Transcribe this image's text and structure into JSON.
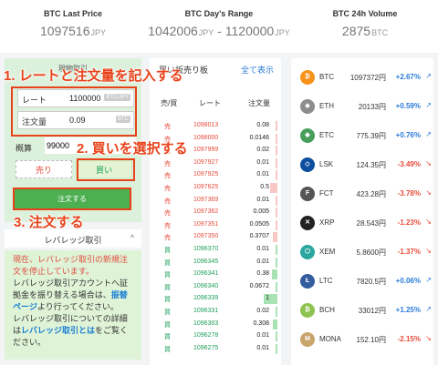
{
  "stats": [
    {
      "label": "BTC Last Price",
      "value": "1097516",
      "unit": "JPY"
    },
    {
      "label": "BTC Day's Range",
      "value": "1042006",
      "unit": "JPY",
      "sep": " - ",
      "value2": "1120000",
      "unit2": "JPY"
    },
    {
      "label": "BTC 24h Volume",
      "value": "2875",
      "unit": "BTC"
    }
  ],
  "order": {
    "title": "現物取引",
    "rate_label": "レート",
    "rate_value": "1100000",
    "rate_tag": "BTC/JPY",
    "amount_label": "注文量",
    "amount_value": "0.09",
    "amount_tag": "BTC",
    "estimate_label": "概算",
    "estimate_value": "99000",
    "sell_label": "売り",
    "buy_label": "買い",
    "submit_label": "注文する"
  },
  "leverage": {
    "header": "レバレッジ取引",
    "chevron": "^",
    "line1": "現在、レバレッジ取引の新規注文を停止しています。",
    "line2": "レバレッジ取引アカウントへ証拠金を振り替える場合は、",
    "link1": "振替ページ",
    "line3": "より行ってください。",
    "line4": "レバレッジ取引についての詳細は",
    "link2": "レバレッジ取引とは",
    "line5": "をご覧ください。"
  },
  "book": {
    "tab": "買い板売り板",
    "show_all": "全て表示",
    "headers": {
      "side": "売/買",
      "rate": "レート",
      "amount": "注文量"
    },
    "rows": [
      {
        "side": "売",
        "rate": "1098013",
        "amount": "0.08",
        "bar": 0.04,
        "type": "sell"
      },
      {
        "side": "売",
        "rate": "1098000",
        "amount": "0.0146",
        "bar": 0.01,
        "type": "sell"
      },
      {
        "side": "売",
        "rate": "1097999",
        "amount": "0.02",
        "bar": 0.01,
        "type": "sell"
      },
      {
        "side": "売",
        "rate": "1097927",
        "amount": "0.01",
        "bar": 0.01,
        "type": "sell"
      },
      {
        "side": "売",
        "rate": "1097925",
        "amount": "0.01",
        "bar": 0.01,
        "type": "sell"
      },
      {
        "side": "売",
        "rate": "1097625",
        "amount": "0.5",
        "bar": 0.25,
        "type": "sell"
      },
      {
        "side": "売",
        "rate": "1097369",
        "amount": "0.01",
        "bar": 0.01,
        "type": "sell"
      },
      {
        "side": "売",
        "rate": "1097362",
        "amount": "0.005",
        "bar": 0.01,
        "type": "sell"
      },
      {
        "side": "売",
        "rate": "1097351",
        "amount": "0.0505",
        "bar": 0.02,
        "type": "sell"
      },
      {
        "side": "売",
        "rate": "1097350",
        "amount": "0.3707",
        "bar": 0.18,
        "type": "sell"
      },
      {
        "side": "買",
        "rate": "1096370",
        "amount": "0.01",
        "bar": 0.01,
        "type": "buy"
      },
      {
        "side": "買",
        "rate": "1096345",
        "amount": "0.01",
        "bar": 0.01,
        "type": "buy"
      },
      {
        "side": "買",
        "rate": "1096341",
        "amount": "0.38",
        "bar": 0.19,
        "type": "buy"
      },
      {
        "side": "買",
        "rate": "1096340",
        "amount": "0.0672",
        "bar": 0.03,
        "type": "buy"
      },
      {
        "side": "買",
        "rate": "1096339",
        "amount": "1",
        "bar": 0.5,
        "type": "buy"
      },
      {
        "side": "買",
        "rate": "1096331",
        "amount": "0.02",
        "bar": 0.01,
        "type": "buy"
      },
      {
        "side": "買",
        "rate": "1096303",
        "amount": "0.308",
        "bar": 0.15,
        "type": "buy"
      },
      {
        "side": "買",
        "rate": "1096278",
        "amount": "0.01",
        "bar": 0.01,
        "type": "buy"
      },
      {
        "side": "買",
        "rate": "1096275",
        "amount": "0.01",
        "bar": 0.01,
        "type": "buy"
      }
    ]
  },
  "market": [
    {
      "sym": "BTC",
      "icon": "bitcoin-icon",
      "glyph": "₿",
      "color": "#f7931a",
      "price": "1097372円",
      "change": "+2.67%",
      "dir": "up"
    },
    {
      "sym": "ETH",
      "icon": "ethereum-icon",
      "glyph": "◆",
      "color": "#8c8c8c",
      "price": "20133円",
      "change": "+0.59%",
      "dir": "up"
    },
    {
      "sym": "ETC",
      "icon": "ethereum-classic-icon",
      "glyph": "◆",
      "color": "#4a9e5c",
      "price": "775.39円",
      "change": "+0.76%",
      "dir": "up"
    },
    {
      "sym": "LSK",
      "icon": "lisk-icon",
      "glyph": "◇",
      "color": "#0d4ea0",
      "price": "124.35円",
      "change": "-3.49%",
      "dir": "dn"
    },
    {
      "sym": "FCT",
      "icon": "factom-icon",
      "glyph": "F",
      "color": "#555555",
      "price": "423.28円",
      "change": "-3.78%",
      "dir": "dn"
    },
    {
      "sym": "XRP",
      "icon": "ripple-icon",
      "glyph": "✕",
      "color": "#222222",
      "price": "28.543円",
      "change": "-1.23%",
      "dir": "dn"
    },
    {
      "sym": "XEM",
      "icon": "nem-icon",
      "glyph": "⬡",
      "color": "#2aa6a0",
      "price": "5.8600円",
      "change": "-1.37%",
      "dir": "dn"
    },
    {
      "sym": "LTC",
      "icon": "litecoin-icon",
      "glyph": "Ł",
      "color": "#345d9d",
      "price": "7820.5円",
      "change": "+0.06%",
      "dir": "up"
    },
    {
      "sym": "BCH",
      "icon": "bitcoin-cash-icon",
      "glyph": "₿",
      "color": "#8dc351",
      "price": "33012円",
      "change": "+1.25%",
      "dir": "up"
    },
    {
      "sym": "MONA",
      "icon": "monacoin-icon",
      "glyph": "M",
      "color": "#c9a46b",
      "price": "152.10円",
      "change": "-2.15%",
      "dir": "dn"
    }
  ],
  "annotations": {
    "step1": "1. レートと注文量を記入する",
    "step2": "2. 買いを選択する",
    "step3": "3. 注文する"
  },
  "colors": {
    "accent": "#e8421a",
    "up": "#2a7ad8",
    "down": "#e74c3c",
    "buy": "#1e9e5a",
    "submit": "#4caf50"
  }
}
